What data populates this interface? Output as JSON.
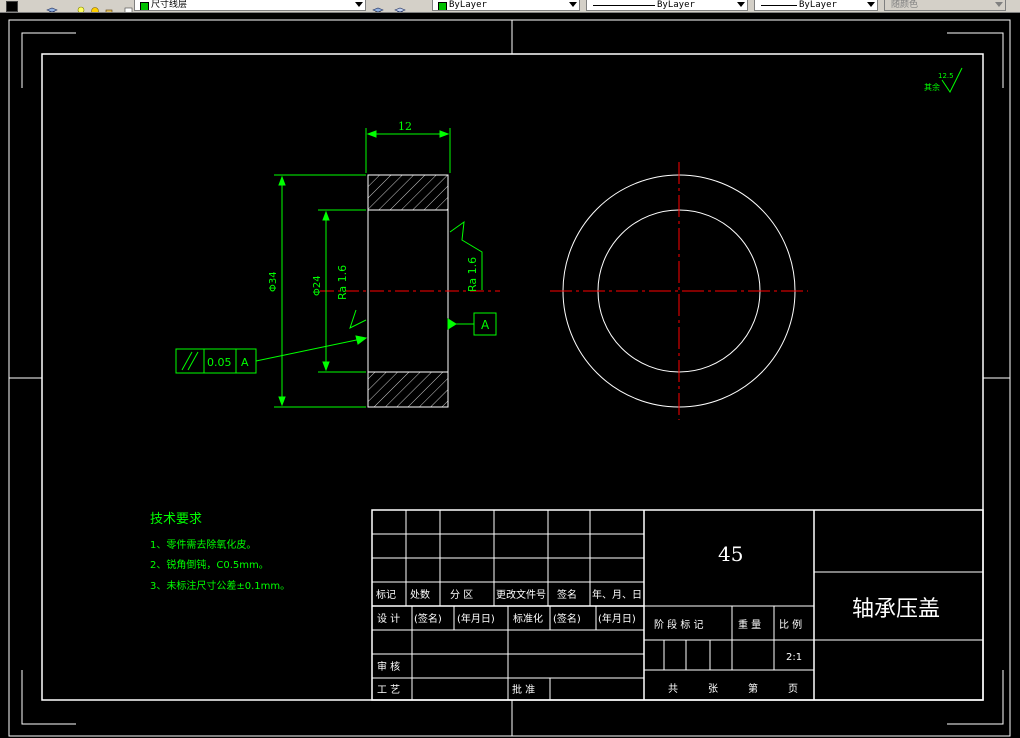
{
  "toolbar": {
    "layer_name": "尺寸线层",
    "color_control": "ByLayer",
    "linetype_control": "ByLayer",
    "lineweight_control": "ByLayer",
    "plotstyle_control": "随颜色"
  },
  "colors": {
    "background": "#000000",
    "frame": "#ffffff",
    "dimension": "#00ff00",
    "centerline": "#ff0000",
    "drawing": "#ffffff"
  },
  "drawing": {
    "dim_width": "12",
    "dim_outer_dia": "Φ34",
    "dim_inner_dia": "Φ24",
    "roughness_left": "Ra 1.6",
    "roughness_right": "Ra 1.6",
    "roughness_rest_label": "其余",
    "roughness_rest_value": "12.5",
    "datum_label": "A",
    "tolerance_value": "0.05",
    "tolerance_datum": "A"
  },
  "tech_requirements": {
    "title": "技术要求",
    "items": [
      "1、零件需去除氧化皮。",
      "2、锐角倒钝，C0.5mm。",
      "3、未标注尺寸公差±0.1mm。"
    ]
  },
  "title_block": {
    "material": "45",
    "part_name": "轴承压盖",
    "revision_headers": [
      "标记",
      "处数",
      "分 区",
      "更改文件号",
      "签名",
      "年、月、日"
    ],
    "design_row": [
      "设 计",
      "(签名)",
      "(年月日)",
      "标准化",
      "(签名)",
      "(年月日)"
    ],
    "review_label": "审 核",
    "process_label": "工 艺",
    "approve_label": "批 准",
    "stage_label": "阶 段 标 记",
    "weight_label": "重 量",
    "scale_label": "比 例",
    "scale_value": "2:1",
    "sheet_total_label": "共",
    "sheet_count_label": "张",
    "sheet_num_label": "第",
    "page_label": "页"
  }
}
